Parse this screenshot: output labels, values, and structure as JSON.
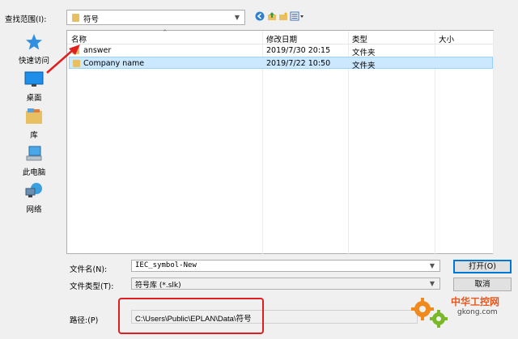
{
  "toolbar": {
    "lookin_label": "查找范围(I):",
    "lookin_value": "符号"
  },
  "places": [
    {
      "label": "快速访问",
      "icon": "star-icon"
    },
    {
      "label": "桌面",
      "icon": "desktop-icon"
    },
    {
      "label": "库",
      "icon": "library-icon"
    },
    {
      "label": "此电脑",
      "icon": "computer-icon"
    },
    {
      "label": "网络",
      "icon": "network-icon"
    }
  ],
  "filelist": {
    "columns": [
      "名称",
      "修改日期",
      "类型",
      "大小"
    ],
    "rows": [
      {
        "name": "answer",
        "date": "2019/7/30 20:15",
        "type": "文件夹",
        "size": ""
      },
      {
        "name": "Company name",
        "date": "2019/7/22 10:50",
        "type": "文件夹",
        "size": ""
      }
    ],
    "selected_index": 1
  },
  "form": {
    "filename_label": "文件名(N):",
    "filename_value": "IEC_symbol-New",
    "filetype_label": "文件类型(T):",
    "filetype_value": "符号库 (*.slk)",
    "open_label": "打开(O)",
    "cancel_label": "取消",
    "path_label": "路径:(P)",
    "path_value": "C:\\Users\\Public\\EPLAN\\Data\\符号"
  },
  "watermark": {
    "line1": "中华工控网",
    "line2": "gkong.com"
  },
  "colors": {
    "selection": "#cce8ff",
    "annotation": "#e02020",
    "folder": "#e8c062"
  }
}
